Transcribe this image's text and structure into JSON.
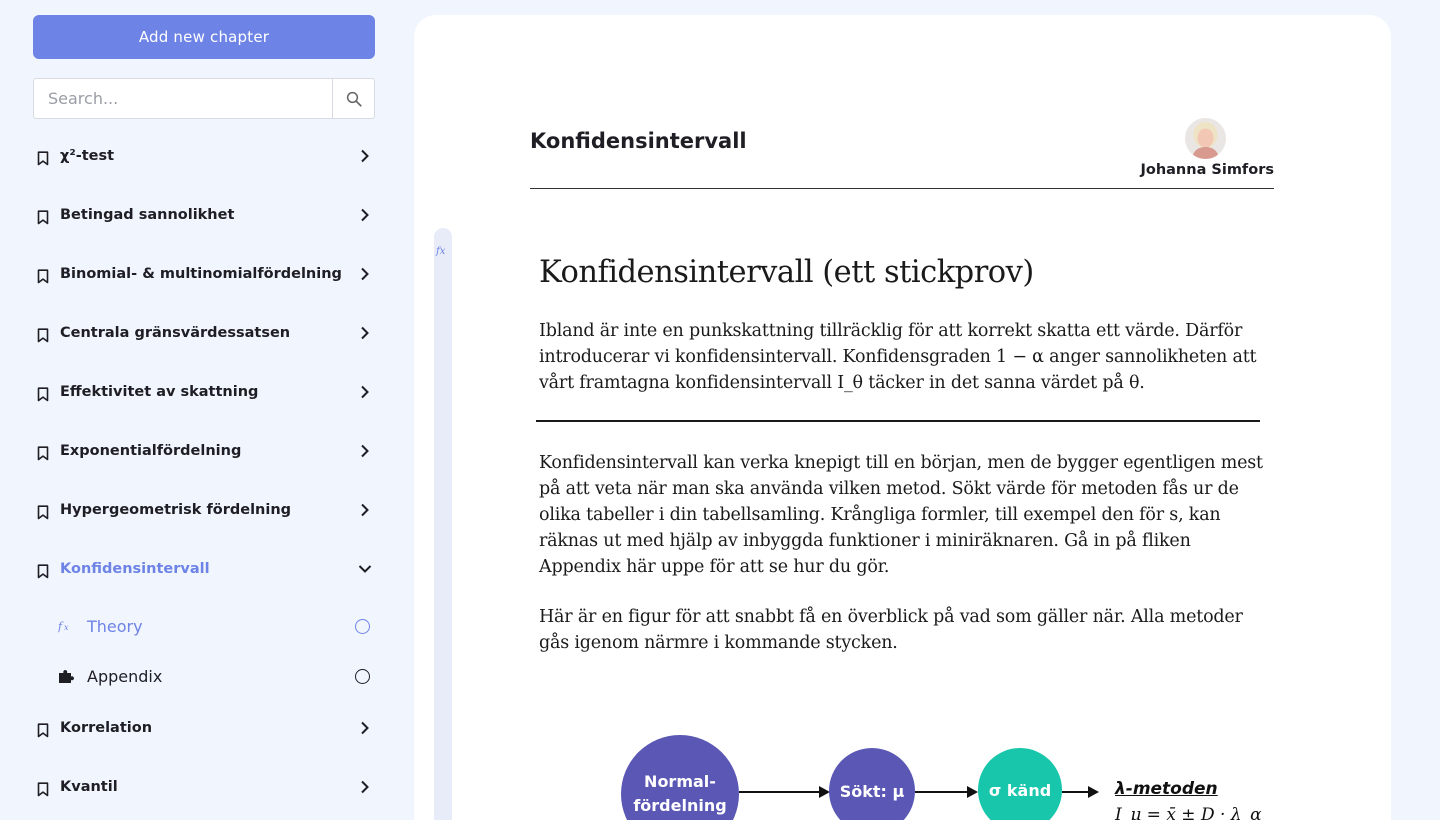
{
  "sidebar": {
    "add_button": "Add new chapter",
    "search_placeholder": "Search...",
    "chapters": [
      {
        "label": "χ²-test"
      },
      {
        "label": "Betingad sannolikhet"
      },
      {
        "label": "Binomial- & multinomialfördelning"
      },
      {
        "label": "Centrala gränsvärdessatsen"
      },
      {
        "label": "Effektivitet av skattning"
      },
      {
        "label": "Exponentialfördelning"
      },
      {
        "label": "Hypergeometrisk fördelning"
      },
      {
        "label": "Konfidensintervall",
        "expanded": true
      },
      {
        "label": "Korrelation"
      },
      {
        "label": "Kvantil"
      }
    ],
    "subitems": [
      {
        "label": "Theory",
        "icon": "fx-icon",
        "current": true
      },
      {
        "label": "Appendix",
        "icon": "puzzle-icon",
        "current": false
      }
    ]
  },
  "main": {
    "title": "Konfidensintervall",
    "author": "Johanna Simfors",
    "rail_icon": "fx",
    "doc": {
      "heading": "Konfidensintervall (ett stickprov)",
      "paragraph1": "Ibland är inte en punkskattning tillräcklig för att korrekt skatta ett värde. Därför introducerar vi konfidensintervall. Konfidensgraden 1 − α anger sannolikheten att vårt framtagna konfidensintervall I_θ täcker in det sanna värdet på θ.",
      "paragraph2": "Konfidensintervall kan verka knepigt till en början, men de bygger egentligen mest på att veta när man ska använda vilken metod. Sökt värde för metoden fås ur de olika tabeller i din tabellsamling. Krångliga formler, till exempel den för s, kan räknas ut med hjälp av inbyggda funktioner i miniräknaren. Gå in på fliken Appendix här uppe för att se hur du gör.",
      "paragraph3": "Här är en figur för att snabbt få en överblick på vad som gäller när. Alla metoder gås igenom närmre i kommande stycken."
    },
    "diagram": {
      "node1": "Normal-\nfördelning",
      "node2": "Sökt: μ",
      "node3": "σ känd",
      "method": "λ-metoden",
      "formula": "I_μ = x̄ ± D · λ_α"
    }
  },
  "colors": {
    "accent": "#6e83e6",
    "background": "#f1f5fd",
    "node_purple": "#5b57b4",
    "node_teal": "#18c6ab"
  }
}
